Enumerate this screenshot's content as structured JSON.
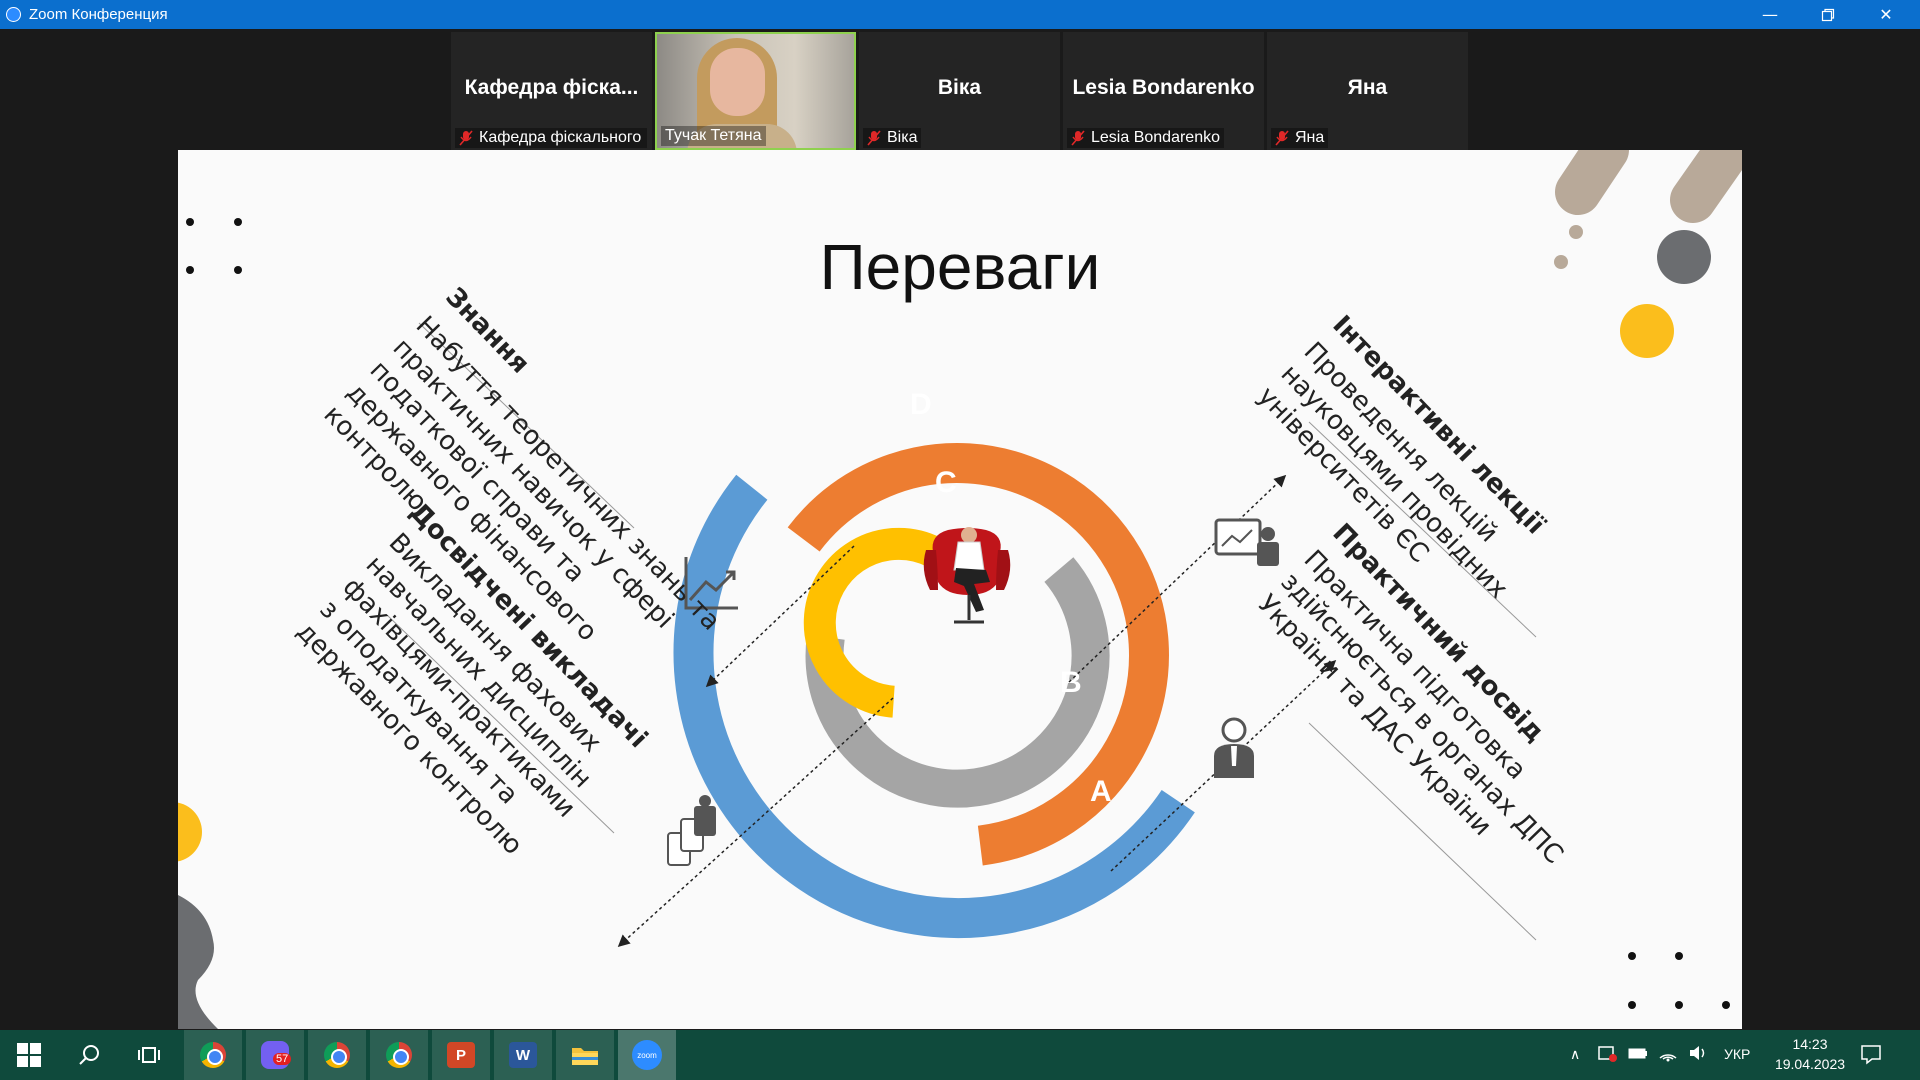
{
  "window": {
    "title": "Zoom Конференция"
  },
  "participants": [
    {
      "display": "Кафедра фіска...",
      "name": "Кафедра фіскального ...",
      "muted": true,
      "video": false
    },
    {
      "display": "",
      "name": "Тучак Тетяна",
      "muted": false,
      "video": true
    },
    {
      "display": "Віка",
      "name": "Віка",
      "muted": true,
      "video": false
    },
    {
      "display": "Lesia Bondarenko",
      "name": "Lesia Bondarenko",
      "muted": true,
      "video": false
    },
    {
      "display": "Яна",
      "name": "Яна",
      "muted": true,
      "video": false
    }
  ],
  "slide": {
    "title": "Переваги",
    "sections": {
      "knowledge": {
        "heading": "Знання",
        "lines": [
          "Набуття теоретичних знань та",
          "практичних навичок у сфері",
          "податкової справи та",
          "державного фінансового",
          "контролю"
        ]
      },
      "teachers": {
        "heading": "Досвідчені викладачі",
        "lines": [
          "Викладання фахових",
          "навчальних дисциплін",
          "фахівцями-практиками",
          "з оподаткування та",
          "державного контролю"
        ]
      },
      "lectures": {
        "heading": "Інтерактивні лекції",
        "lines": [
          "Проведення лекцій",
          "науковцями провідних",
          "університетів ЄС"
        ]
      },
      "practice": {
        "heading": "Практичний досвід",
        "lines": [
          "Практична підготовка",
          "здійснюється в органах ДПС",
          "України та ДАС України"
        ]
      }
    },
    "ring_labels": {
      "a": "A",
      "b": "B",
      "c": "C",
      "d": "D"
    },
    "colors": {
      "orange": "#ED7D31",
      "blue": "#5B9BD5",
      "gray": "#A5A5A5",
      "yellow": "#FFC000"
    }
  },
  "taskbar": {
    "viber_badge": "57",
    "language": "УКР",
    "time": "14:23",
    "date": "19.04.2023",
    "apps": [
      "windows-start",
      "search",
      "task-view",
      "chrome",
      "viber",
      "chrome-profile",
      "chrome",
      "powerpoint",
      "word",
      "file-explorer",
      "zoom"
    ]
  }
}
